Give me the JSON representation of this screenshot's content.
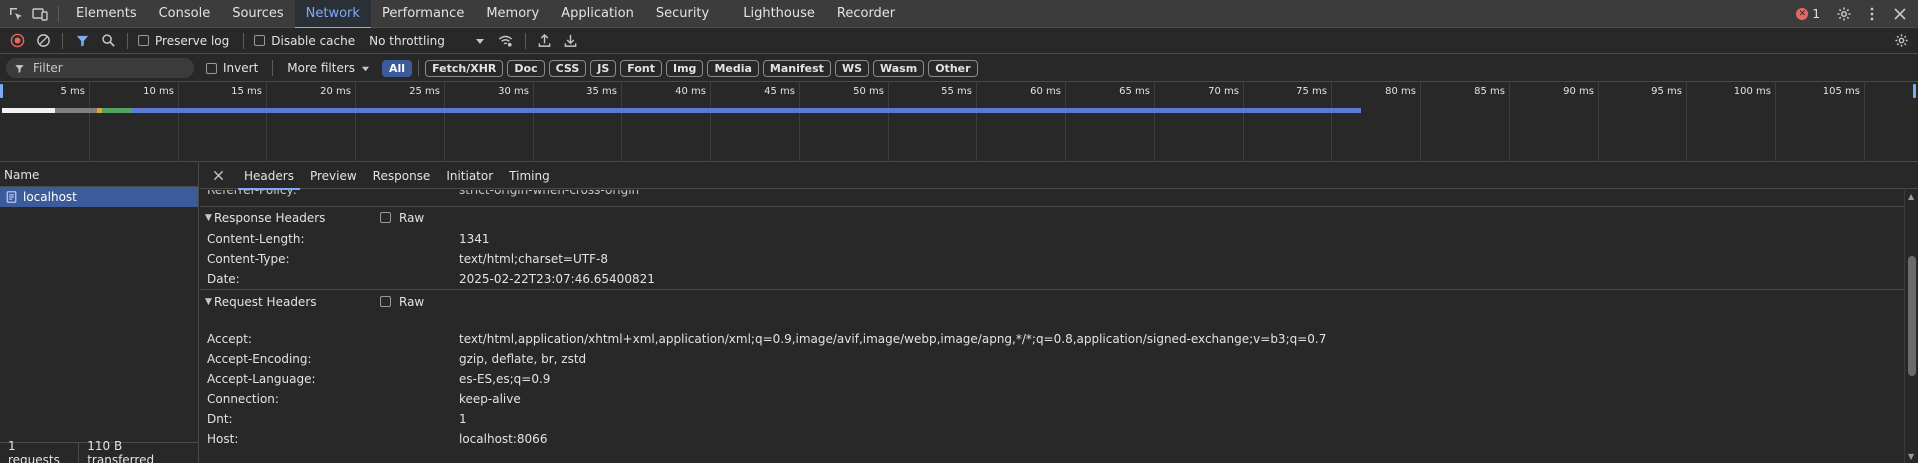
{
  "top_tabs": [
    "Elements",
    "Console",
    "Sources",
    "Network",
    "Performance",
    "Memory",
    "Application",
    "Security",
    "Lighthouse",
    "Recorder"
  ],
  "active_tab": "Network",
  "error_count": "1",
  "toolbar": {
    "preserve_log": "Preserve log",
    "disable_cache": "Disable cache",
    "throttling": "No throttling"
  },
  "filter": {
    "placeholder": "Filter",
    "invert": "Invert",
    "more_filters": "More filters",
    "types": [
      "All",
      "Fetch/XHR",
      "Doc",
      "CSS",
      "JS",
      "Font",
      "Img",
      "Media",
      "Manifest",
      "WS",
      "Wasm",
      "Other"
    ],
    "active_type": "All"
  },
  "timeline": {
    "ticks": [
      "5 ms",
      "10 ms",
      "15 ms",
      "20 ms",
      "25 ms",
      "30 ms",
      "35 ms",
      "40 ms",
      "45 ms",
      "50 ms",
      "55 ms",
      "60 ms",
      "65 ms",
      "70 ms",
      "75 ms",
      "80 ms",
      "85 ms",
      "90 ms",
      "95 ms",
      "100 ms",
      "105 ms"
    ]
  },
  "requests": {
    "column_name": "Name",
    "items": [
      {
        "name": "localhost"
      }
    ],
    "summary_requests": "1 requests",
    "summary_transferred": "110 B transferred"
  },
  "details": {
    "tabs": [
      "Headers",
      "Preview",
      "Response",
      "Initiator",
      "Timing"
    ],
    "active_tab": "Headers",
    "cut_off_row": {
      "key": "Referrer-Policy:",
      "value": "strict-origin-when-cross-origin"
    },
    "response_headers": {
      "title": "Response Headers",
      "raw_label": "Raw",
      "rows": [
        {
          "key": "Content-Length:",
          "value": "1341"
        },
        {
          "key": "Content-Type:",
          "value": "text/html;charset=UTF-8"
        },
        {
          "key": "Date:",
          "value": "2025-02-22T23:07:46.65400821"
        }
      ]
    },
    "request_headers": {
      "title": "Request Headers",
      "raw_label": "Raw",
      "rows": [
        {
          "key": "Accept:",
          "value": "text/html,application/xhtml+xml,application/xml;q=0.9,image/avif,image/webp,image/apng,*/*;q=0.8,application/signed-exchange;v=b3;q=0.7"
        },
        {
          "key": "Accept-Encoding:",
          "value": "gzip, deflate, br, zstd"
        },
        {
          "key": "Accept-Language:",
          "value": "es-ES,es;q=0.9"
        },
        {
          "key": "Connection:",
          "value": "keep-alive"
        },
        {
          "key": "Dnt:",
          "value": "1"
        },
        {
          "key": "Host:",
          "value": "localhost:8066"
        }
      ]
    }
  },
  "colors": {
    "accent": "#7cacf8",
    "selected_row": "#3c5b9a",
    "timeline_bar": "#5b7bd5",
    "error": "#e46962"
  }
}
